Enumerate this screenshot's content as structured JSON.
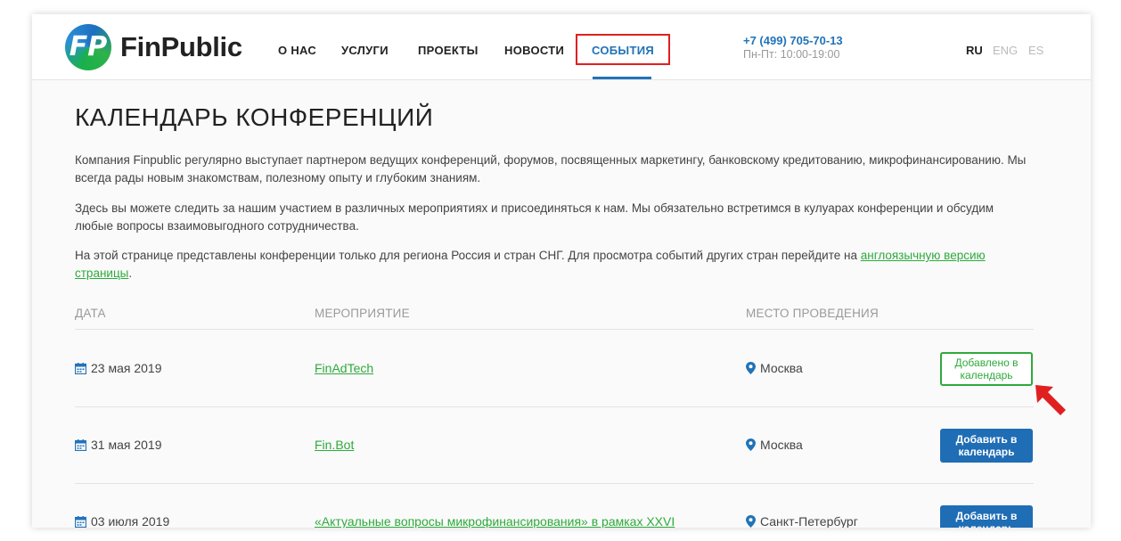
{
  "header": {
    "logo_text": "FinPublic",
    "logo_letters": "FP",
    "nav": [
      {
        "label": "О НАС",
        "active": false
      },
      {
        "label": "УСЛУГИ",
        "active": false
      },
      {
        "label": "ПРОЕКТЫ",
        "active": false
      },
      {
        "label": "НОВОСТИ",
        "active": false
      },
      {
        "label": "СОБЫТИЯ",
        "active": true
      }
    ],
    "phone": "+7 (499) 705-70-13",
    "hours": "Пн-Пт: 10:00-19:00",
    "languages": [
      {
        "label": "RU",
        "active": true
      },
      {
        "label": "ENG",
        "active": false
      },
      {
        "label": "ES",
        "active": false
      }
    ]
  },
  "main": {
    "title": "КАЛЕНДАРЬ КОНФЕРЕНЦИЙ",
    "paragraph1": "Компания Finpublic регулярно выступает партнером ведущих конференций, форумов, посвященных маркетингу, банковскому кредитованию, микрофинансированию. Мы всегда рады новым знакомствам, полезному опыту и глубоким знаниям.",
    "paragraph2": "Здесь вы можете следить за нашим участием в различных мероприятиях и присоединяться к нам. Мы обязательно встретимся в кулуарах конференции и обсудим любые вопросы взаимовыгодного сотрудничества.",
    "paragraph3_text": "На этой странице представлены конференции только для региона Россия и стран СНГ. Для просмотра событий других стран перейдите на ",
    "paragraph3_link": "англоязычную версию страницы",
    "paragraph3_end": "."
  },
  "table": {
    "headers": {
      "date": "ДАТА",
      "event": "МЕРОПРИЯТИЕ",
      "place": "МЕСТО ПРОВЕДЕНИЯ"
    },
    "rows": [
      {
        "date": "23 мая 2019",
        "event": "FinAdTech",
        "place": "Москва",
        "button": "Добавлено в календарь",
        "added": true
      },
      {
        "date": "31 мая 2019",
        "event": "Fin.Bot",
        "place": "Москва",
        "button": "Добавить в календарь",
        "added": false
      },
      {
        "date": "03 июля 2019",
        "event": "«Актуальные вопросы микрофинансирования» в рамках XXVI",
        "place": "Санкт-Петербург",
        "button": "Добавить в календарь",
        "added": false
      }
    ]
  },
  "colors": {
    "accent_blue": "#2173b8",
    "link_green": "#2eaa3c",
    "highlight_red": "#e02020",
    "button_blue": "#1f6db5"
  },
  "icons": {
    "date": "calendar-icon",
    "place": "map-pin-icon",
    "annotation": "red-arrow-icon"
  }
}
